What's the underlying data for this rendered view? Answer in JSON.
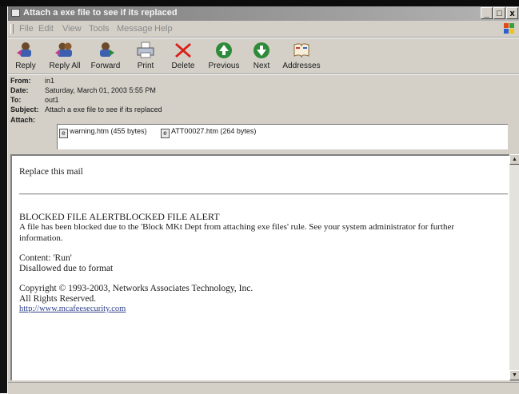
{
  "window": {
    "title": "Attach a exe file to see if its replaced",
    "controls": {
      "minimize": "_",
      "maximize": "□",
      "close": "x"
    }
  },
  "menu": [
    "File",
    "Edit",
    "View",
    "Tools",
    "Message",
    "Help"
  ],
  "toolbar": [
    {
      "label": "Reply",
      "icon": "reply-icon"
    },
    {
      "label": "Reply All",
      "icon": "reply-all-icon"
    },
    {
      "label": "Forward",
      "icon": "forward-icon"
    },
    {
      "label": "Print",
      "icon": "print-icon"
    },
    {
      "label": "Delete",
      "icon": "delete-icon"
    },
    {
      "label": "Previous",
      "icon": "previous-icon"
    },
    {
      "label": "Next",
      "icon": "next-icon"
    },
    {
      "label": "Addresses",
      "icon": "address-book-icon"
    }
  ],
  "header": {
    "from_label": "From:",
    "from": "in1",
    "date_label": "Date:",
    "date": "Saturday, March 01, 2003 5:55 PM",
    "to_label": "To:",
    "to": "out1",
    "subject_label": "Subject:",
    "subject": "Attach a exe file to see if its replaced",
    "attach_label": "Attach:",
    "attachments": [
      "warning.htm (455 bytes)",
      "ATT00027.htm (264 bytes)"
    ]
  },
  "body": {
    "line1": "Replace this mail",
    "alert_title": "BLOCKED FILE ALERTBLOCKED FILE ALERT",
    "alert_text_1": "A file has been blocked due to the 'Block MKt Dept from attaching exe files' rule. See your system administrator for further",
    "alert_text_2": "information.",
    "content": "Content: 'Run'",
    "disallowed": "Disallowed due to format",
    "copyright": "Copyright © 1993-2003, Networks Associates Technology, Inc.",
    "rights": "All Rights Reserved.",
    "link": "http://www.mcafeesecurity.com"
  },
  "colors": {
    "delete_red": "#d8201a",
    "nav_green": "#2e8b3a",
    "link_blue": "#2d3f8c"
  }
}
